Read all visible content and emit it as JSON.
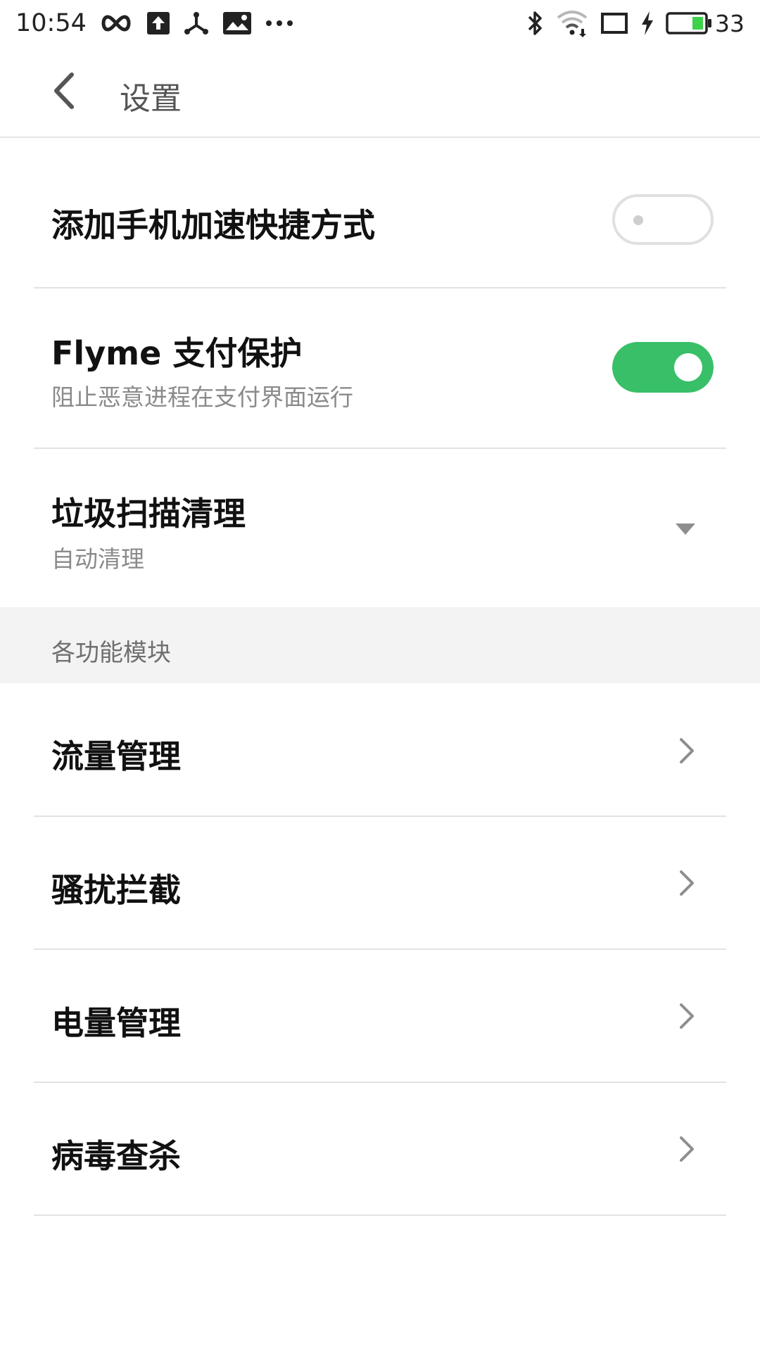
{
  "status_bar": {
    "time": "10:54",
    "battery_percent": "33",
    "battery_color": "#3ed14a",
    "icons_left": [
      "infinity-icon",
      "upload-icon",
      "share-icon",
      "image-icon",
      "more-icon"
    ],
    "icons_right": [
      "bluetooth-icon",
      "wifi-icon",
      "screen-icon",
      "charging-icon",
      "battery-icon"
    ]
  },
  "header": {
    "back_icon": "chevron-left-icon",
    "title": "设置"
  },
  "settings": {
    "shortcut": {
      "title": "添加手机加速快捷方式",
      "enabled": false
    },
    "payment_protect": {
      "title": "Flyme 支付保护",
      "subtitle": "阻止恶意进程在支付界面运行",
      "enabled": true
    },
    "junk_clean": {
      "title": "垃圾扫描清理",
      "subtitle": "自动清理",
      "icon": "dropdown-triangle-icon"
    }
  },
  "section": {
    "title": "各功能模块"
  },
  "modules": [
    {
      "label": "流量管理",
      "icon": "chevron-right-icon"
    },
    {
      "label": "骚扰拦截",
      "icon": "chevron-right-icon"
    },
    {
      "label": "电量管理",
      "icon": "chevron-right-icon"
    },
    {
      "label": "病毒查杀",
      "icon": "chevron-right-icon"
    }
  ],
  "colors": {
    "accent_green": "#38bf68",
    "title_text": "#111111",
    "subtitle_text": "#8a8a8a",
    "section_bg": "#f3f3f3"
  }
}
